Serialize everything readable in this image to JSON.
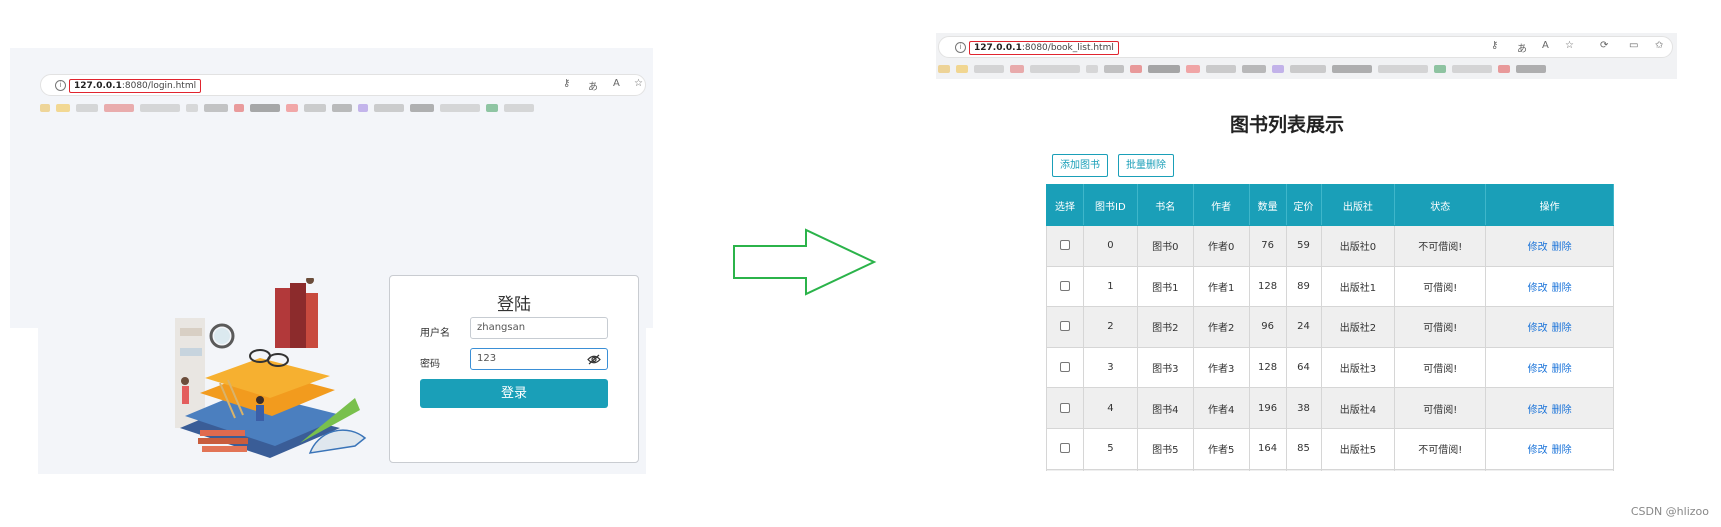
{
  "login_page": {
    "url_host": "127.0.0.1",
    "url_rest": ":8080/login.html",
    "title": "登陆",
    "username_label": "用户名",
    "username_value": "zhangsan",
    "password_label": "密码",
    "password_value": "123",
    "submit_label": "登录"
  },
  "book_list_page": {
    "url_host": "127.0.0.1",
    "url_rest": ":8080/book_list.html",
    "title": "图书列表展示",
    "add_button": "添加图书",
    "batch_delete_button": "批量删除",
    "columns": [
      "选择",
      "图书ID",
      "书名",
      "作者",
      "数量",
      "定价",
      "出版社",
      "状态",
      "操作"
    ],
    "edit_label": "修改",
    "delete_label": "删除",
    "rows": [
      {
        "id": "0",
        "name": "图书0",
        "author": "作者0",
        "count": "76",
        "price": "59",
        "publisher": "出版社0",
        "status": "不可借阅!"
      },
      {
        "id": "1",
        "name": "图书1",
        "author": "作者1",
        "count": "128",
        "price": "89",
        "publisher": "出版社1",
        "status": "可借阅!"
      },
      {
        "id": "2",
        "name": "图书2",
        "author": "作者2",
        "count": "96",
        "price": "24",
        "publisher": "出版社2",
        "status": "可借阅!"
      },
      {
        "id": "3",
        "name": "图书3",
        "author": "作者3",
        "count": "128",
        "price": "64",
        "publisher": "出版社3",
        "status": "可借阅!"
      },
      {
        "id": "4",
        "name": "图书4",
        "author": "作者4",
        "count": "196",
        "price": "38",
        "publisher": "出版社4",
        "status": "可借阅!"
      },
      {
        "id": "5",
        "name": "图书5",
        "author": "作者5",
        "count": "164",
        "price": "85",
        "publisher": "出版社5",
        "status": "不可借阅!"
      }
    ]
  },
  "watermark": "CSDN @hlizoo",
  "colors": {
    "accent": "#1a9fb8",
    "url_highlight": "#e0242e",
    "arrow": "#2bb34a",
    "link": "#1a73d9"
  }
}
